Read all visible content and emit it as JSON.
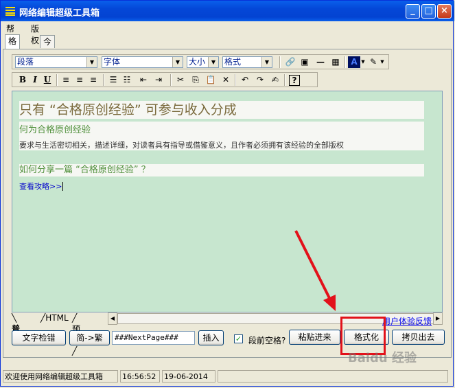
{
  "window": {
    "title": "网络编辑超级工具箱"
  },
  "menu": [
    "帮助",
    "版权"
  ],
  "tabs": [
    "格式化",
    "今日焦点"
  ],
  "toolbar": {
    "paragraph": "段落",
    "font": "字体",
    "size": "大小",
    "format": "格式",
    "bold": "B",
    "italic": "I",
    "underline": "U"
  },
  "editor": {
    "heading": "只有 “合格原创经验” 可参与收入分成",
    "subheading": "何为合格原创经验",
    "description": "要求与生活密切相关，描述详细，对读者具有指导或借鉴意义，且作者必须拥有该经验的全部版权",
    "question": "如何分享一篇 “合格原创经验” ？",
    "link": "查看攻略>>"
  },
  "bottom_tabs": [
    "普通",
    "HTML",
    "预览"
  ],
  "feedback": "用户体验反馈",
  "controls": {
    "spellcheck": "文字检错",
    "convert": "简->繁",
    "nextpage": "###NextPage###",
    "insert": "插入",
    "space_label": "段前空格?",
    "paste": "粘贴进来",
    "format": "格式化",
    "copy": "拷贝出去"
  },
  "status": {
    "message": "欢迎使用网络编辑超级工具箱",
    "time": "16:56:52",
    "date": "19-06-2014"
  },
  "watermark": "Baidu 经验",
  "colors": {
    "titlebar": "#0A5FEB",
    "editor_bg": "#C7E6CF",
    "highlight": "#E2111A"
  }
}
